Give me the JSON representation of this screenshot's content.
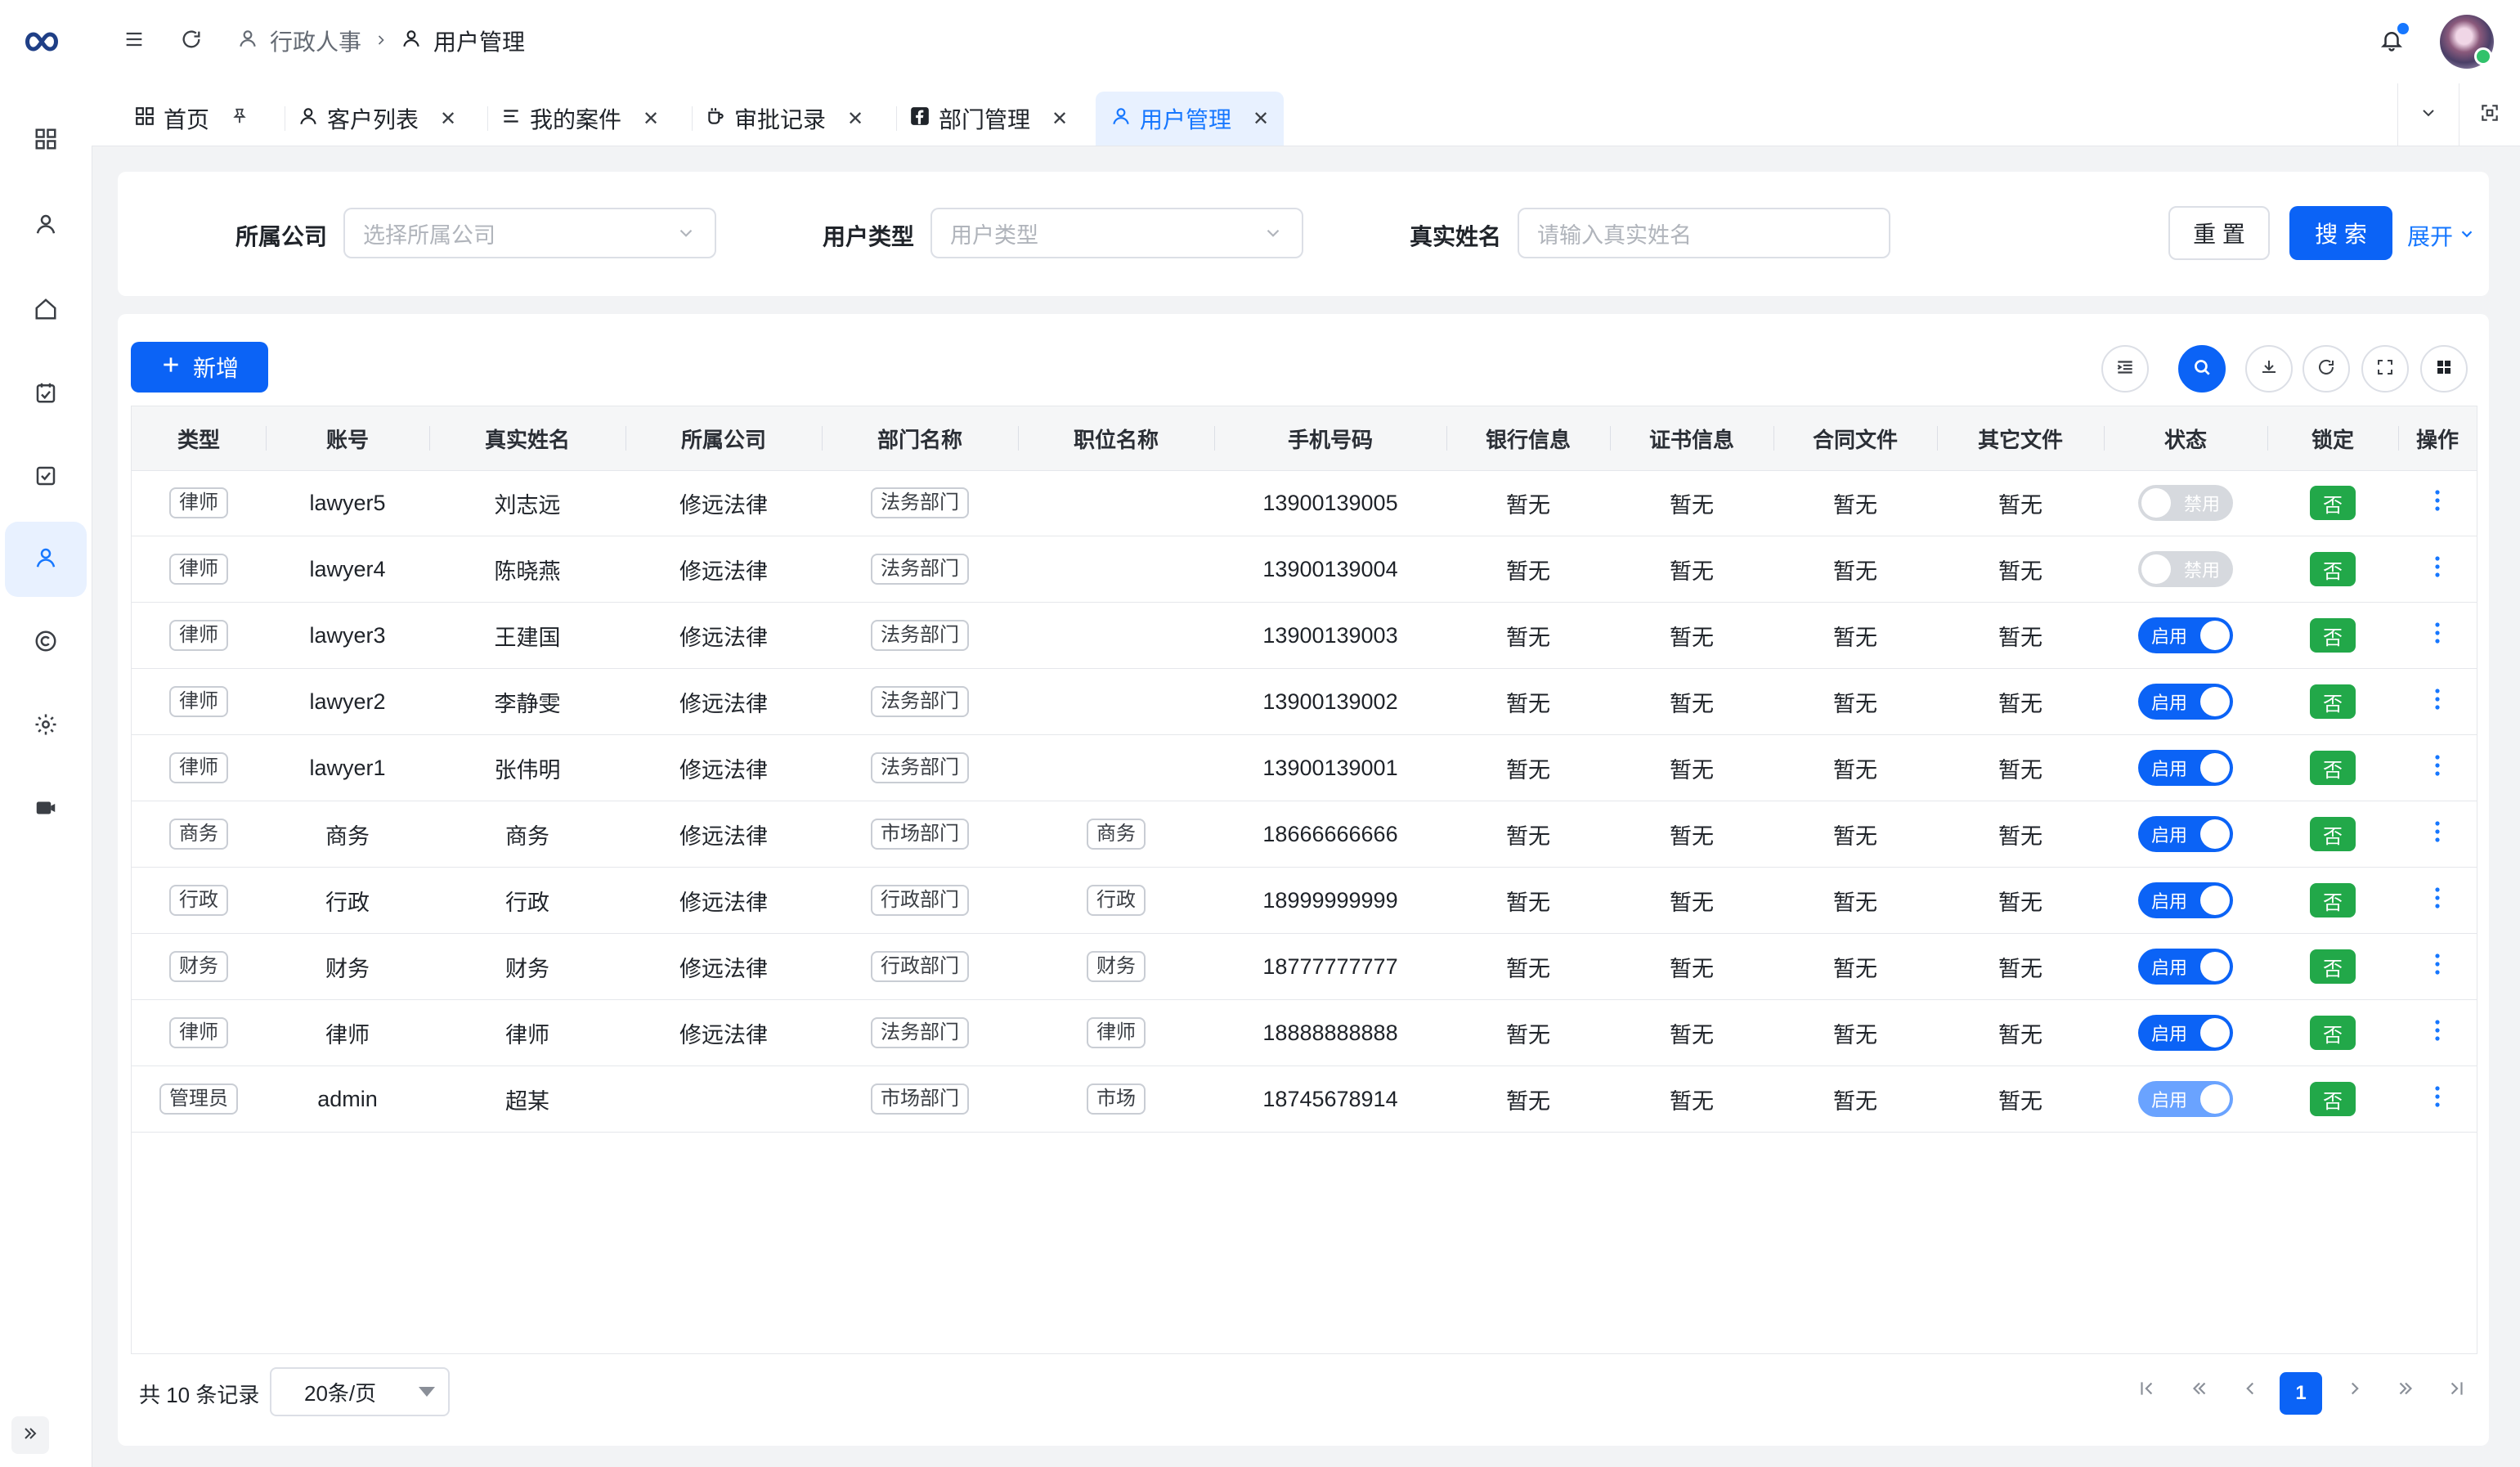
{
  "colors": {
    "accent": "#1677ff",
    "primary": "#0b63f6",
    "lock_green": "#22a849"
  },
  "sidebar": {
    "logo_icon": "infinity-logo",
    "items": [
      {
        "icon": "dashboard-icon"
      },
      {
        "icon": "user-icon"
      },
      {
        "icon": "home-icon"
      },
      {
        "icon": "calendar-icon"
      },
      {
        "icon": "checklist-icon"
      },
      {
        "icon": "user-icon",
        "active": true
      },
      {
        "icon": "copyright-icon"
      },
      {
        "icon": "gear-icon"
      },
      {
        "icon": "camera-icon"
      }
    ],
    "collapse_icon": "double-chevron-right-icon"
  },
  "header": {
    "breadcrumb": [
      {
        "label": "行政人事"
      },
      {
        "label": "用户管理"
      }
    ]
  },
  "tabs": [
    {
      "label": "首页",
      "icon": "dashboard-icon",
      "end": "pin"
    },
    {
      "label": "客户列表",
      "icon": "user-icon",
      "end": "close"
    },
    {
      "label": "我的案件",
      "icon": "list-icon",
      "end": "close"
    },
    {
      "label": "审批记录",
      "icon": "cup-icon",
      "end": "close"
    },
    {
      "label": "部门管理",
      "icon": "facebook-icon",
      "end": "close"
    },
    {
      "label": "用户管理",
      "icon": "user-icon",
      "end": "close",
      "active": true
    }
  ],
  "filter": {
    "company_label": "所属公司",
    "company_placeholder": "选择所属公司",
    "type_label": "用户类型",
    "type_placeholder": "用户类型",
    "name_label": "真实姓名",
    "name_placeholder": "请输入真实姓名",
    "reset_label": "重 置",
    "search_label": "搜 索",
    "expand_label": "展开"
  },
  "toolbar": {
    "add_label": "新增"
  },
  "table": {
    "columns": [
      "类型",
      "账号",
      "真实姓名",
      "所属公司",
      "部门名称",
      "职位名称",
      "手机号码",
      "银行信息",
      "证书信息",
      "合同文件",
      "其它文件",
      "状态",
      "锁定",
      "操作"
    ],
    "rows": [
      {
        "type": "律师",
        "account": "lawyer5",
        "name": "刘志远",
        "company": "修远法律",
        "dept": "法务部门",
        "position": "",
        "phone": "13900139005",
        "bank": "暂无",
        "cert": "暂无",
        "contract": "暂无",
        "other": "暂无",
        "status": "禁用",
        "status_on": false,
        "lock": "否"
      },
      {
        "type": "律师",
        "account": "lawyer4",
        "name": "陈晓燕",
        "company": "修远法律",
        "dept": "法务部门",
        "position": "",
        "phone": "13900139004",
        "bank": "暂无",
        "cert": "暂无",
        "contract": "暂无",
        "other": "暂无",
        "status": "禁用",
        "status_on": false,
        "lock": "否"
      },
      {
        "type": "律师",
        "account": "lawyer3",
        "name": "王建国",
        "company": "修远法律",
        "dept": "法务部门",
        "position": "",
        "phone": "13900139003",
        "bank": "暂无",
        "cert": "暂无",
        "contract": "暂无",
        "other": "暂无",
        "status": "启用",
        "status_on": true,
        "lock": "否"
      },
      {
        "type": "律师",
        "account": "lawyer2",
        "name": "李静雯",
        "company": "修远法律",
        "dept": "法务部门",
        "position": "",
        "phone": "13900139002",
        "bank": "暂无",
        "cert": "暂无",
        "contract": "暂无",
        "other": "暂无",
        "status": "启用",
        "status_on": true,
        "lock": "否"
      },
      {
        "type": "律师",
        "account": "lawyer1",
        "name": "张伟明",
        "company": "修远法律",
        "dept": "法务部门",
        "position": "",
        "phone": "13900139001",
        "bank": "暂无",
        "cert": "暂无",
        "contract": "暂无",
        "other": "暂无",
        "status": "启用",
        "status_on": true,
        "lock": "否"
      },
      {
        "type": "商务",
        "account": "商务",
        "name": "商务",
        "company": "修远法律",
        "dept": "市场部门",
        "position": "商务",
        "phone": "18666666666",
        "bank": "暂无",
        "cert": "暂无",
        "contract": "暂无",
        "other": "暂无",
        "status": "启用",
        "status_on": true,
        "lock": "否"
      },
      {
        "type": "行政",
        "account": "行政",
        "name": "行政",
        "company": "修远法律",
        "dept": "行政部门",
        "position": "行政",
        "phone": "18999999999",
        "bank": "暂无",
        "cert": "暂无",
        "contract": "暂无",
        "other": "暂无",
        "status": "启用",
        "status_on": true,
        "lock": "否"
      },
      {
        "type": "财务",
        "account": "财务",
        "name": "财务",
        "company": "修远法律",
        "dept": "行政部门",
        "position": "财务",
        "phone": "18777777777",
        "bank": "暂无",
        "cert": "暂无",
        "contract": "暂无",
        "other": "暂无",
        "status": "启用",
        "status_on": true,
        "lock": "否"
      },
      {
        "type": "律师",
        "account": "律师",
        "name": "律师",
        "company": "修远法律",
        "dept": "法务部门",
        "position": "律师",
        "phone": "18888888888",
        "bank": "暂无",
        "cert": "暂无",
        "contract": "暂无",
        "other": "暂无",
        "status": "启用",
        "status_on": true,
        "lock": "否"
      },
      {
        "type": "管理员",
        "account": "admin",
        "name": "超某",
        "company": "",
        "dept": "市场部门",
        "position": "市场",
        "phone": "18745678914",
        "bank": "暂无",
        "cert": "暂无",
        "contract": "暂无",
        "other": "暂无",
        "status": "启用",
        "status_on": true,
        "lock": "否",
        "soft": true
      }
    ]
  },
  "footer": {
    "total_text": "共 10 条记录",
    "page_size": "20条/页",
    "current_page": "1"
  }
}
